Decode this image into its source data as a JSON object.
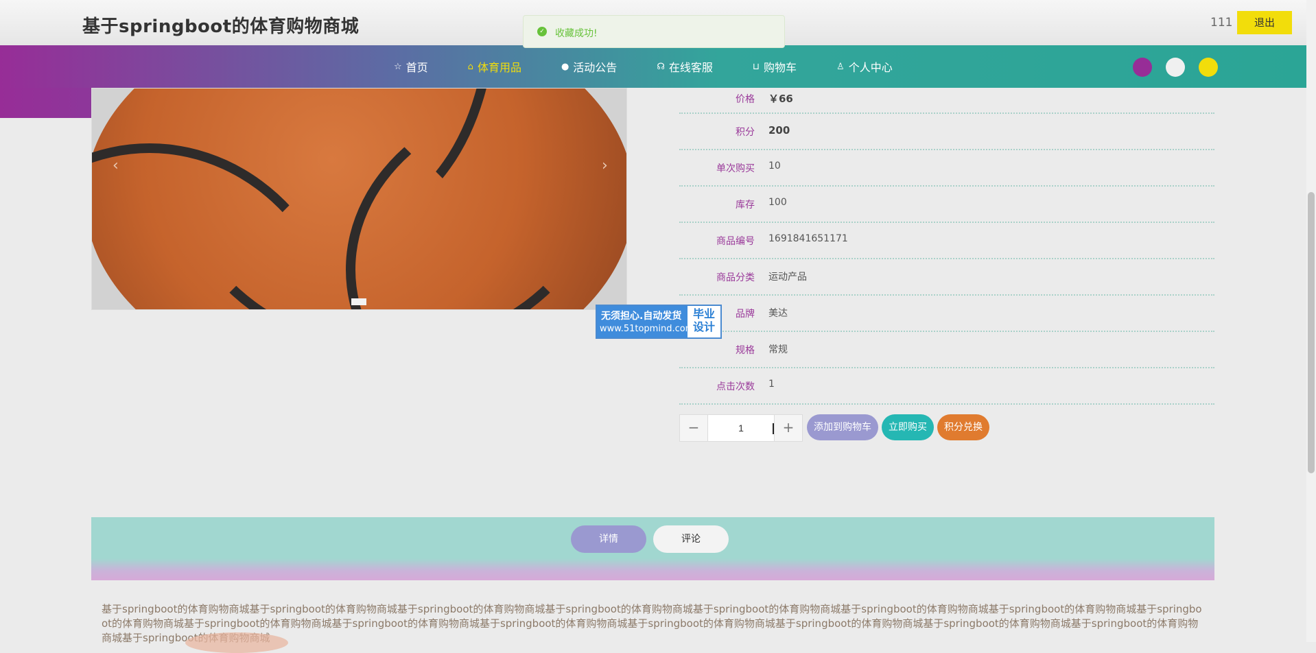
{
  "site": {
    "title": "基于springboot的体育购物商城"
  },
  "user": {
    "name": "111",
    "logout_label": "退出"
  },
  "toast": {
    "message": "收藏成功!"
  },
  "nav": {
    "items": [
      {
        "label": "首页",
        "icon": "star-icon"
      },
      {
        "label": "体育用品",
        "icon": "bag-icon",
        "active": true
      },
      {
        "label": "活动公告",
        "icon": "info-icon"
      },
      {
        "label": "在线客服",
        "icon": "headset-icon"
      },
      {
        "label": "购物车",
        "icon": "cart-icon"
      },
      {
        "label": "个人中心",
        "icon": "user-icon"
      }
    ]
  },
  "theme_colors": [
    "#972d97",
    "#f0f0f0",
    "#f2dd0b"
  ],
  "carousel": {
    "prev": "‹",
    "next": "›"
  },
  "watermark": {
    "line1": "无须担心.自动发货",
    "line2": "www.51topmind.com",
    "right": "毕业设计"
  },
  "details": [
    {
      "label": "价格",
      "value": "￥66"
    },
    {
      "label": "积分",
      "value": "200"
    },
    {
      "label": "单次购买",
      "value": "10"
    },
    {
      "label": "库存",
      "value": "100"
    },
    {
      "label": "商品编号",
      "value": "1691841651171"
    },
    {
      "label": "商品分类",
      "value": "运动产品"
    },
    {
      "label": "品牌",
      "value": "美达"
    },
    {
      "label": "规格",
      "value": "常规"
    },
    {
      "label": "点击次数",
      "value": "1"
    }
  ],
  "quantity": {
    "value": "1",
    "minus": "−",
    "plus": "+"
  },
  "actions": {
    "add_to_cart": "添加到购物车",
    "buy_now": "立即购买",
    "points_exchange": "积分兑换"
  },
  "tabs": {
    "details": "详情",
    "comments": "评论"
  },
  "description": "基于springboot的体育购物商城基于springboot的体育购物商城基于springboot的体育购物商城基于springboot的体育购物商城基于springboot的体育购物商城基于springboot的体育购物商城基于springboot的体育购物商城基于springboot的体育购物商城基于springboot的体育购物商城基于springboot的体育购物商城基于springboot的体育购物商城基于springboot的体育购物商城基于springboot的体育购物商城基于springboot的体育购物商城基于springboot的体育购物商城基于springboot的体育购物商城"
}
